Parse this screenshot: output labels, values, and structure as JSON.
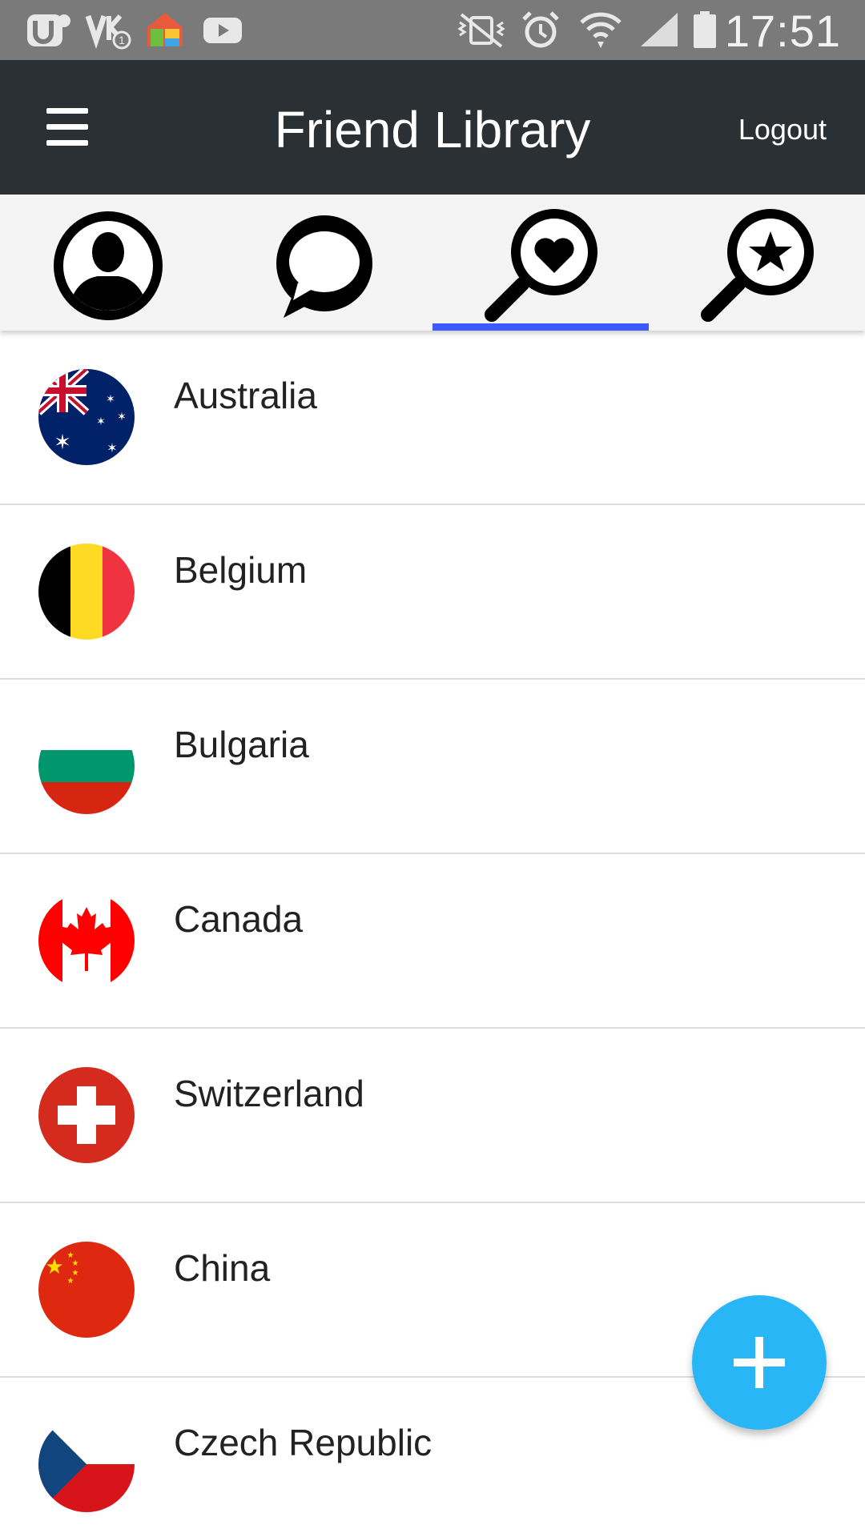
{
  "status_bar": {
    "time": "17:51",
    "left_icons": [
      "u-app-icon",
      "vk-notification-icon",
      "home-app-icon",
      "youtube-icon"
    ],
    "right_icons": [
      "vibrate-mute-icon",
      "alarm-icon",
      "wifi-icon",
      "signal-icon",
      "battery-icon"
    ]
  },
  "app_bar": {
    "title": "Friend Library",
    "logout_label": "Logout",
    "background_color": "#2b3034"
  },
  "tabs": [
    {
      "icon": "profile-icon",
      "selected": false
    },
    {
      "icon": "chat-icon",
      "selected": false
    },
    {
      "icon": "search-heart-icon",
      "selected": true
    },
    {
      "icon": "search-star-icon",
      "selected": false
    }
  ],
  "accent_color": "#3d5afe",
  "countries": [
    {
      "name": "Australia",
      "flag": "australia-flag-icon"
    },
    {
      "name": "Belgium",
      "flag": "belgium-flag-icon"
    },
    {
      "name": "Bulgaria",
      "flag": "bulgaria-flag-icon"
    },
    {
      "name": "Canada",
      "flag": "canada-flag-icon"
    },
    {
      "name": "Switzerland",
      "flag": "switzerland-flag-icon"
    },
    {
      "name": "China",
      "flag": "china-flag-icon"
    },
    {
      "name": "Czech Republic",
      "flag": "czech-flag-icon"
    }
  ],
  "fab": {
    "icon": "plus-icon",
    "color": "#29b6f6"
  }
}
